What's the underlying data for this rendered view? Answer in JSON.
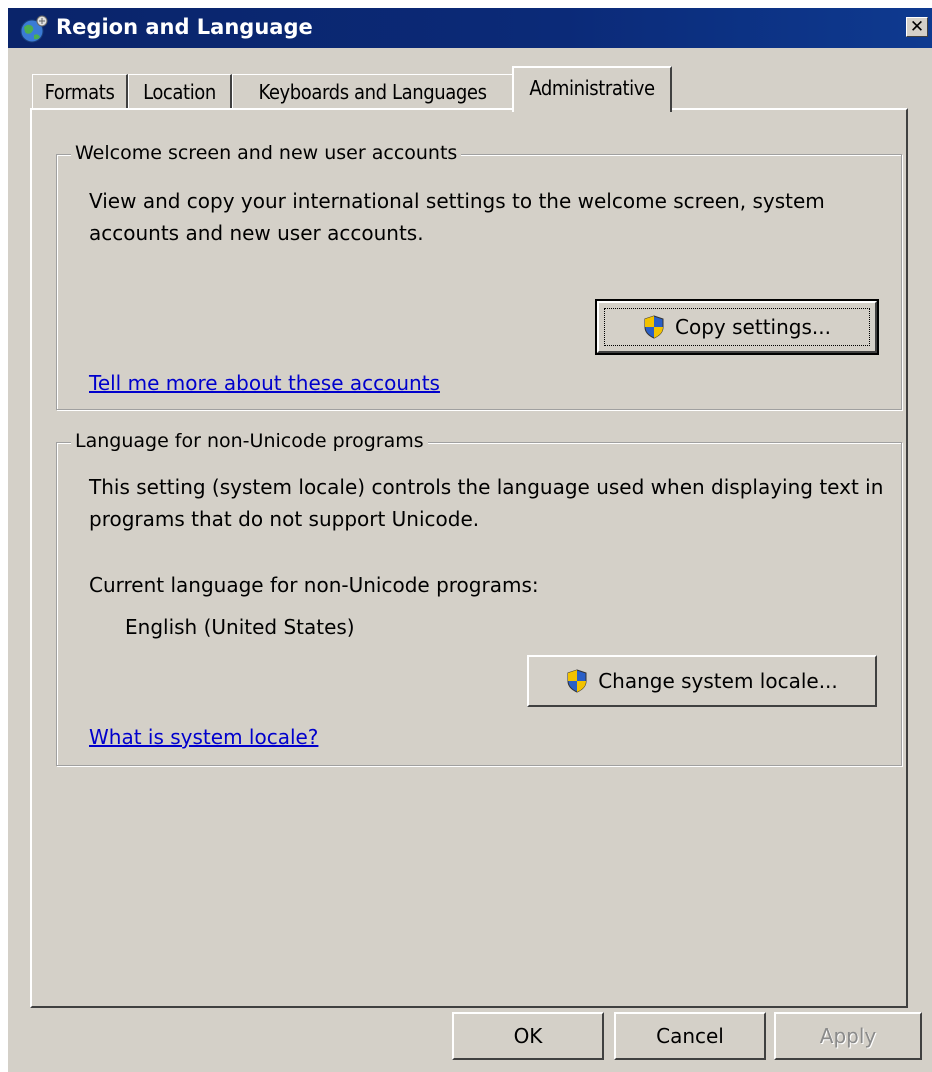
{
  "window": {
    "title": "Region and Language",
    "close_glyph": "✕",
    "title_icon": "globe-icon"
  },
  "tabs": [
    {
      "label": "Formats",
      "active": false
    },
    {
      "label": "Location",
      "active": false
    },
    {
      "label": "Keyboards and Languages",
      "active": false
    },
    {
      "label": "Administrative",
      "active": true
    }
  ],
  "welcome_group": {
    "legend": "Welcome screen and new user accounts",
    "description": "View and copy your international settings to the welcome screen, system accounts and new user accounts.",
    "copy_button": "Copy settings...",
    "link": "Tell me more about these accounts"
  },
  "locale_group": {
    "legend": "Language for non-Unicode programs",
    "description": "This setting (system locale) controls the language used when displaying text in programs that do not support Unicode.",
    "current_label": "Current language for non-Unicode programs:",
    "current_value": "English (United States)",
    "change_button": "Change system locale...",
    "link": "What is system locale?"
  },
  "footer": {
    "ok": "OK",
    "cancel": "Cancel",
    "apply": "Apply"
  },
  "colors": {
    "dialog_bg": "#d4d0c8",
    "titlebar": "#0a246a",
    "link": "#0000cc"
  }
}
